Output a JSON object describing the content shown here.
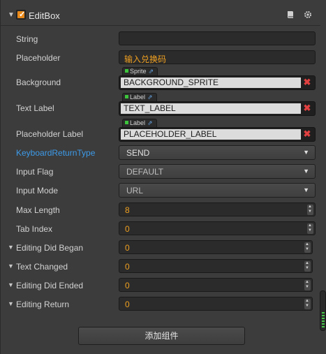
{
  "header": {
    "title": "EditBox"
  },
  "fields": {
    "string": {
      "label": "String",
      "value": ""
    },
    "placeholder": {
      "label": "Placeholder",
      "value": "输入兑换码"
    },
    "background": {
      "label": "Background",
      "tag": "Sprite",
      "value": "BACKGROUND_SPRITE"
    },
    "text_label": {
      "label": "Text Label",
      "tag": "Label",
      "value": "TEXT_LABEL"
    },
    "placeholder_label": {
      "label": "Placeholder Label",
      "tag": "Label",
      "value": "PLACEHOLDER_LABEL"
    },
    "keyboard_return_type": {
      "label": "KeyboardReturnType",
      "value": "SEND"
    },
    "input_flag": {
      "label": "Input Flag",
      "value": "DEFAULT"
    },
    "input_mode": {
      "label": "Input Mode",
      "value": "URL"
    },
    "max_length": {
      "label": "Max Length",
      "value": "8"
    },
    "tab_index": {
      "label": "Tab Index",
      "value": "0"
    },
    "editing_did_began": {
      "label": "Editing Did Began",
      "value": "0"
    },
    "text_changed": {
      "label": "Text Changed",
      "value": "0"
    },
    "editing_did_ended": {
      "label": "Editing Did Ended",
      "value": "0"
    },
    "editing_return": {
      "label": "Editing Return",
      "value": "0"
    }
  },
  "add_component_button": "添加组件",
  "colors": {
    "accent": "#e8891a",
    "highlight_label": "#3d9bea",
    "remove": "#e14040"
  }
}
